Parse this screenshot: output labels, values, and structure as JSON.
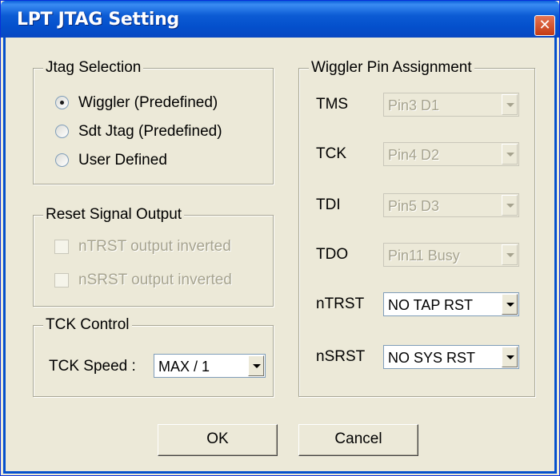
{
  "window": {
    "title": "LPT JTAG Setting",
    "close_glyph": "✕"
  },
  "jtag_selection": {
    "title": "Jtag Selection",
    "options": [
      {
        "label": "Wiggler  (Predefined)",
        "checked": true
      },
      {
        "label": "Sdt Jtag  (Predefined)",
        "checked": false
      },
      {
        "label": "User Defined",
        "checked": false
      }
    ]
  },
  "reset_signal": {
    "title": "Reset Signal Output",
    "options": [
      {
        "label": "nTRST output inverted",
        "checked": false,
        "enabled": false
      },
      {
        "label": "nSRST output inverted",
        "checked": false,
        "enabled": false
      }
    ]
  },
  "tck_control": {
    "title": "TCK Control",
    "speed_label": "TCK Speed :",
    "speed_value": "MAX / 1"
  },
  "pin_assignment": {
    "title": "Wiggler Pin Assignment",
    "rows": [
      {
        "label": "TMS",
        "value": "Pin3  D1",
        "enabled": false
      },
      {
        "label": "TCK",
        "value": "Pin4  D2",
        "enabled": false
      },
      {
        "label": "TDI",
        "value": "Pin5  D3",
        "enabled": false
      },
      {
        "label": "TDO",
        "value": "Pin11  Busy",
        "enabled": false
      },
      {
        "label": "nTRST",
        "value": "NO TAP RST",
        "enabled": true
      },
      {
        "label": "nSRST",
        "value": "NO SYS RST",
        "enabled": true
      }
    ]
  },
  "buttons": {
    "ok": "OK",
    "cancel": "Cancel"
  }
}
